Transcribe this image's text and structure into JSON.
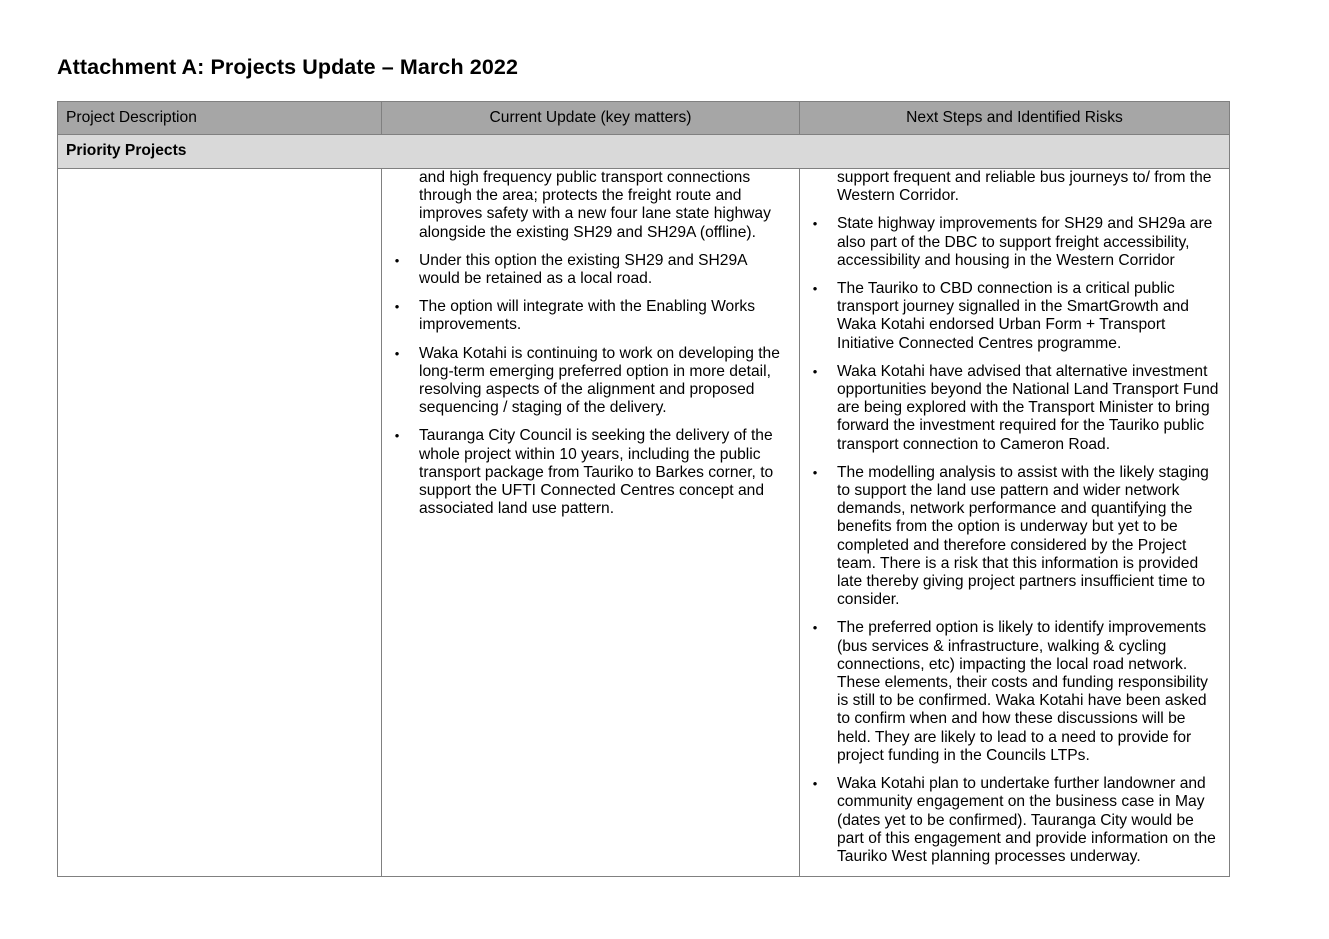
{
  "title": "Attachment A: Projects Update – March 2022",
  "table": {
    "headers": {
      "description": "Project Description",
      "update": "Current Update (key matters)",
      "risks": "Next Steps and Identified Risks"
    },
    "section": "Priority Projects",
    "description_text": "",
    "bullet_glyph": "•",
    "update_continuation": "and high frequency public transport connections through the area; protects the freight route and improves safety with a new four lane state highway alongside the existing SH29 and SH29A (offline).",
    "update_items": [
      "Under this option the existing SH29 and SH29A would be retained as a local road.",
      "The option will integrate with the Enabling Works improvements.",
      "Waka Kotahi is continuing to work on developing the long-term emerging preferred option in more detail, resolving aspects of the alignment and proposed sequencing / staging of the delivery.",
      "Tauranga City Council is seeking the delivery of the whole project within 10 years, including the public transport package from Tauriko to Barkes corner, to support the UFTI Connected Centres concept and associated land use pattern."
    ],
    "risks_continuation": "support frequent and reliable bus journeys to/ from the Western Corridor.",
    "risks_items": [
      "State highway improvements for SH29 and SH29a are also part of the DBC to support freight accessibility, accessibility and housing in the Western Corridor",
      "The Tauriko to CBD connection is a critical public transport journey signalled in the SmartGrowth and Waka Kotahi endorsed Urban Form + Transport Initiative Connected Centres programme.",
      "Waka Kotahi have advised that alternative investment opportunities beyond the National Land Transport Fund are being explored with the Transport Minister to bring forward the investment required for the Tauriko public transport connection to Cameron Road.",
      "The modelling analysis to assist with the likely staging to support the land use pattern and wider network demands, network performance and quantifying the benefits from the option is underway but yet to be completed and therefore considered by the Project team. There is a risk that this information is provided late thereby giving project partners insufficient time to consider.",
      "The preferred option is likely to identify improvements (bus services & infrastructure, walking & cycling connections, etc) impacting the local road network. These elements, their costs and funding responsibility is still to be confirmed. Waka Kotahi have been asked to confirm when and how these discussions will be held. They are likely to lead to a need to provide for project funding in the Councils LTPs.",
      "Waka Kotahi plan to undertake further landowner and community engagement on the business case in May (dates yet to be confirmed). Tauranga City would be part of this engagement and provide information on the Tauriko West planning processes underway."
    ]
  }
}
